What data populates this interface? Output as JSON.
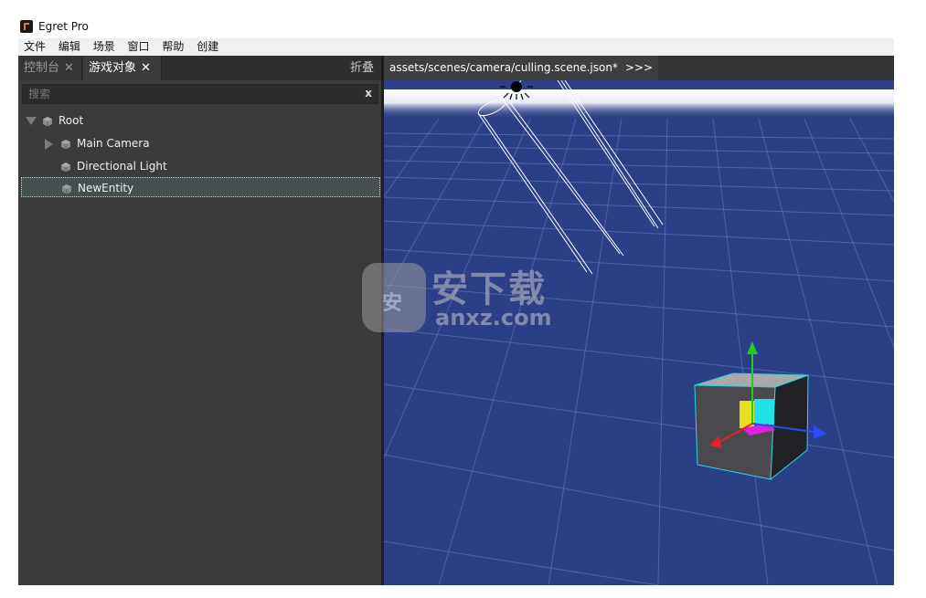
{
  "app": {
    "title": "Egret Pro"
  },
  "menu": [
    "文件",
    "编辑",
    "场景",
    "窗口",
    "帮助",
    "创建"
  ],
  "left_panel": {
    "tabs": [
      {
        "label": "控制台",
        "close": "✕"
      },
      {
        "label": "游戏对象",
        "close": "✕"
      }
    ],
    "fold_label": "折叠",
    "search": {
      "placeholder": "搜索",
      "value": "",
      "clear": "x"
    },
    "tree": [
      {
        "label": "Root",
        "expanded": true,
        "level": 0
      },
      {
        "label": "Main Camera",
        "expanded": false,
        "level": 1
      },
      {
        "label": "Directional Light",
        "level": 1
      },
      {
        "label": "NewEntity",
        "level": 1,
        "selected": true
      }
    ]
  },
  "scene_tab": {
    "label": "assets/scenes/camera/culling.scene.json*",
    "more": ">>>"
  },
  "watermark": {
    "badge": "安",
    "title": "安下载",
    "domain": "anxz.com"
  },
  "colors": {
    "viewport_blue": "#2b3f86",
    "panel_bg": "#3b3b3b",
    "gizmo_x": "#e8202a",
    "gizmo_y": "#22cc22",
    "gizmo_z": "#2a4cff",
    "selection_outline": "#2fd4e0"
  }
}
